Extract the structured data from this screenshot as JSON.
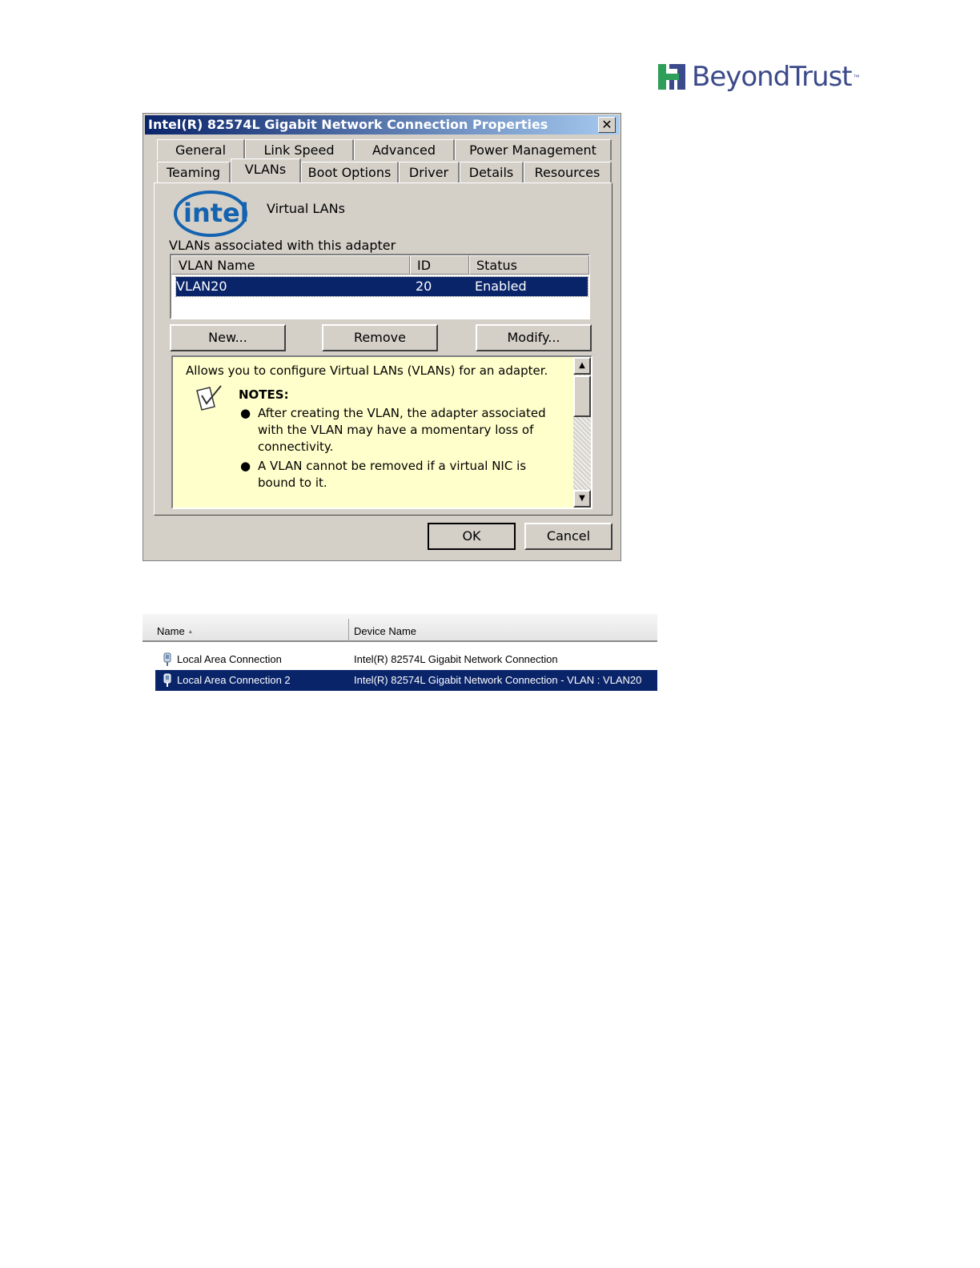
{
  "brand": {
    "name": "BeyondTrust",
    "tm": "™",
    "color": "#3b4a8a",
    "mark_color": "#2e9f5a"
  },
  "dialog": {
    "title": "Intel(R) 82574L Gigabit Network Connection Properties",
    "close_glyph": "✕",
    "tabs_row1": [
      "General",
      "Link Speed",
      "Advanced",
      "Power Management"
    ],
    "tabs_row2": [
      "Teaming",
      "VLANs",
      "Boot Options",
      "Driver",
      "Details",
      "Resources"
    ],
    "active_tab": "VLANs",
    "intel_logo_text": "intel",
    "heading": "Virtual LANs",
    "list_label": "VLANs associated with this adapter",
    "columns": [
      "VLAN Name",
      "ID",
      "Status"
    ],
    "rows": [
      {
        "name": "VLAN20",
        "id": "20",
        "status": "Enabled"
      }
    ],
    "buttons": {
      "new": "New...",
      "remove": "Remove",
      "modify": "Modify..."
    },
    "help": {
      "intro": "Allows you to configure Virtual LANs (VLANs) for an adapter.",
      "notes_title": "NOTES:",
      "notes": [
        "After creating the VLAN, the adapter associated with the VLAN may have a momentary loss of connectivity.",
        "A VLAN cannot be removed if a virtual NIC is bound to it."
      ]
    },
    "ok": "OK",
    "cancel": "Cancel"
  },
  "explorer": {
    "columns": [
      "Name",
      "Device Name"
    ],
    "sort_glyph": "▲",
    "rows": [
      {
        "name": "Local Area Connection",
        "device": "Intel(R) 82574L Gigabit Network Connection",
        "selected": false
      },
      {
        "name": "Local Area Connection 2",
        "device": "Intel(R) 82574L Gigabit Network Connection - VLAN : VLAN20",
        "selected": true
      }
    ]
  }
}
